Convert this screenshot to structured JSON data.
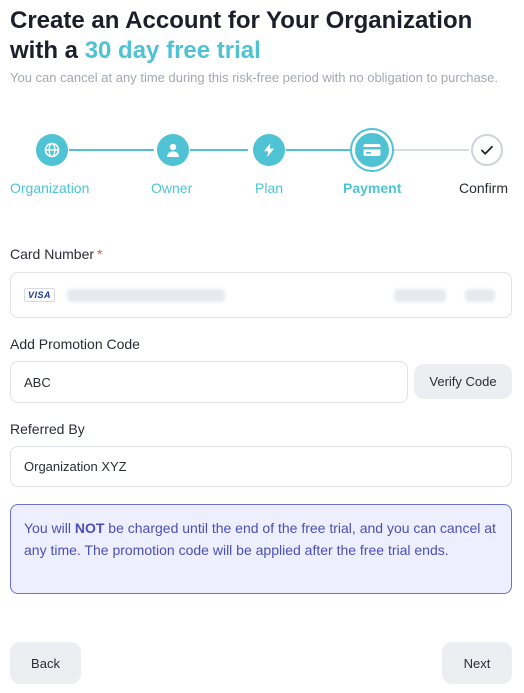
{
  "header": {
    "title_main": "Create an Account for Your Organization with a",
    "title_accent": "30 day free trial",
    "subtitle": "You can cancel at any time during this risk-free period with no obligation to purchase."
  },
  "stepper": {
    "steps": [
      {
        "label": "Organization",
        "icon": "globe-icon",
        "state": "done"
      },
      {
        "label": "Owner",
        "icon": "user-icon",
        "state": "done"
      },
      {
        "label": "Plan",
        "icon": "lightning-icon",
        "state": "done"
      },
      {
        "label": "Payment",
        "icon": "credit-card-icon",
        "state": "current"
      },
      {
        "label": "Confirm",
        "icon": "check-icon",
        "state": "pending"
      }
    ]
  },
  "form": {
    "card": {
      "label": "Card Number",
      "required_mark": "*",
      "brand": "VISA"
    },
    "promo": {
      "label": "Add Promotion Code",
      "value": "ABC",
      "verify_label": "Verify Code"
    },
    "referral": {
      "label": "Referred By",
      "value": "Organization XYZ"
    }
  },
  "notice": {
    "prefix": "You will ",
    "emphasis": "NOT",
    "suffix": " be charged until the end of the free trial, and you can cancel at any time. The promotion code will be applied after the free trial ends."
  },
  "footer": {
    "back_label": "Back",
    "next_label": "Next"
  },
  "colors": {
    "accent": "#4fc3d3",
    "notice_text": "#4b4fb8",
    "notice_bg": "#eeeffe",
    "required": "#e5534b"
  }
}
